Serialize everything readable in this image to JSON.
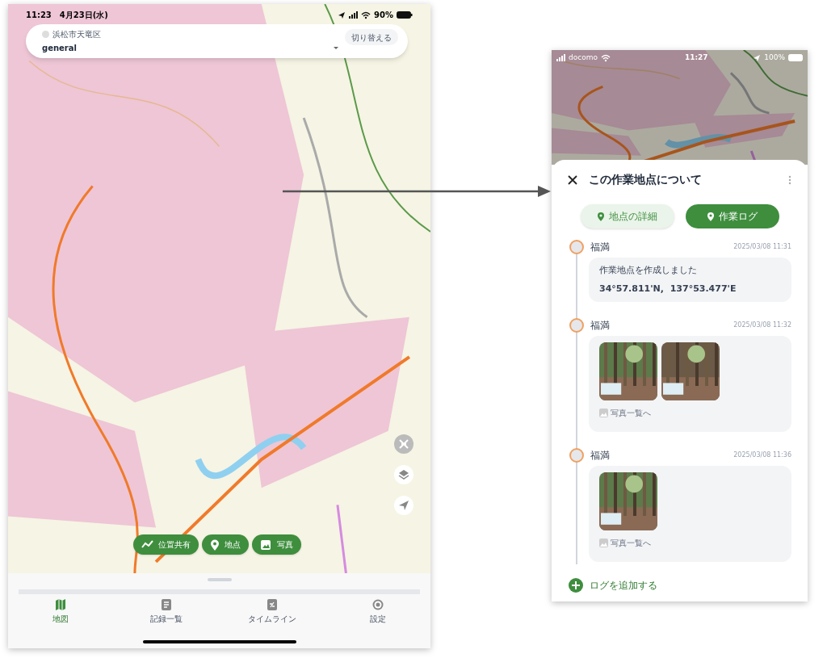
{
  "map_screen": {
    "status_bar": {
      "time": "11:23",
      "date": "4月23日(水)",
      "battery": "90%"
    },
    "area_card": {
      "region": "浜松市天竜区",
      "name": "general",
      "switch_button": "切り替える"
    },
    "map_actions": [
      {
        "label": "位置共有",
        "kind": "track"
      },
      {
        "label": "地点",
        "kind": "pin"
      },
      {
        "label": "写真"
      }
    ],
    "tabs": [
      {
        "label": "地図",
        "kind": "map",
        "selected": true
      },
      {
        "label": "記録一覧",
        "kind": "list",
        "selected": false
      },
      {
        "label": "タイムライン",
        "kind": "timeline",
        "selected": false
      },
      {
        "label": "設定",
        "kind": "settings",
        "selected": false
      }
    ]
  },
  "detail_screen": {
    "status_bar": {
      "carrier": "docomo",
      "time": "11:27",
      "battery": "100%"
    },
    "title": "この作業地点について",
    "tabs": [
      {
        "label": "地点の詳細",
        "selected": false
      },
      {
        "label": "作業ログ",
        "selected": true
      }
    ],
    "logs": [
      {
        "author": "福満",
        "time": "2025/03/08 11:31",
        "kind": "text",
        "lines": [
          "作業地点を作成しました",
          "34°57.811'N,  137°53.477'E"
        ]
      },
      {
        "author": "福満",
        "time": "2025/03/08 11:32",
        "kind": "photos",
        "link": "写真一覧へ"
      },
      {
        "author": "福満",
        "time": "2025/03/08 11:36",
        "kind": "photos",
        "link": "写真一覧へ"
      }
    ],
    "add_button": "ログを追加する"
  }
}
